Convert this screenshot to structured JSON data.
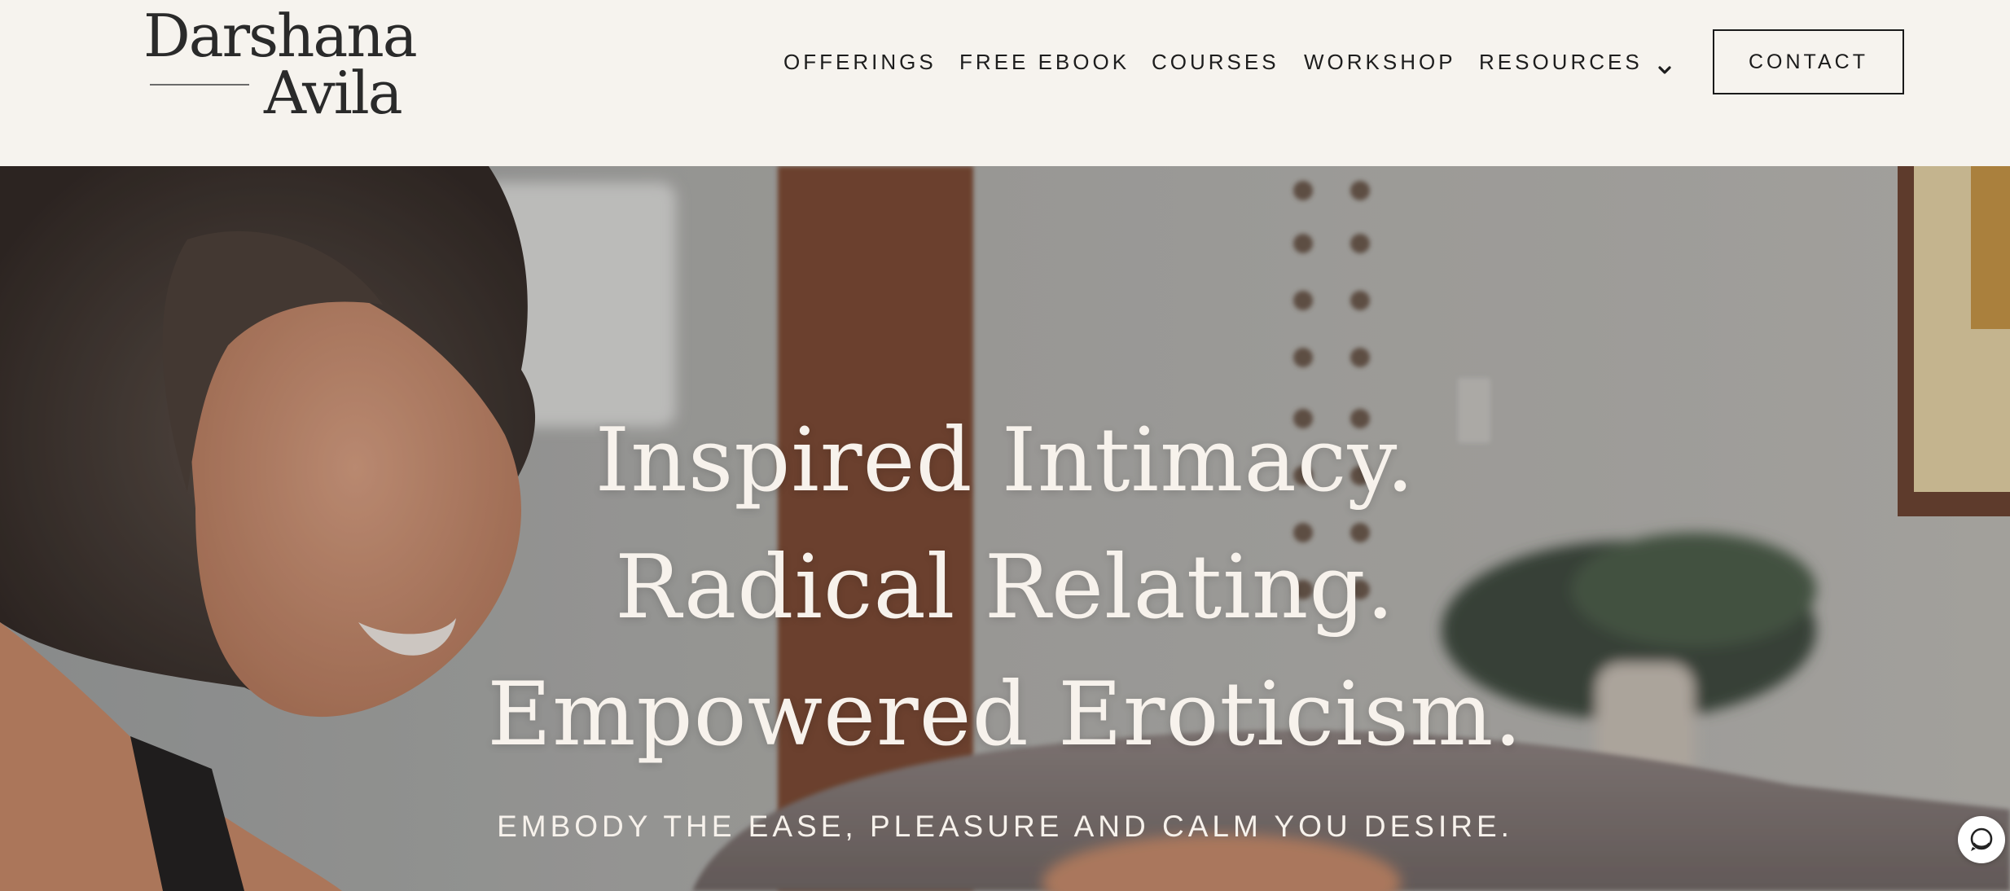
{
  "logo": {
    "line1": "Darshana",
    "line2": "Avila"
  },
  "nav": {
    "items": [
      {
        "label": "OFFERINGS"
      },
      {
        "label": "FREE EBOOK"
      },
      {
        "label": "COURSES"
      },
      {
        "label": "WORKSHOP"
      },
      {
        "label": "RESOURCES"
      }
    ],
    "contact_label": "CONTACT"
  },
  "hero": {
    "headline_1": "Inspired Intimacy.",
    "headline_2": "Radical Relating.",
    "headline_3": "Empowered Eroticism.",
    "subheading": "EMBODY THE EASE, PLEASURE AND CALM YOU DESIRE."
  },
  "icons": {
    "resources_dropdown": "chevron-down-icon",
    "chat": "chat-bubble-icon"
  },
  "colors": {
    "header_bg": "#f6f3ee",
    "text_dark": "#1d1d1d",
    "hero_text": "#f7f2ec"
  }
}
